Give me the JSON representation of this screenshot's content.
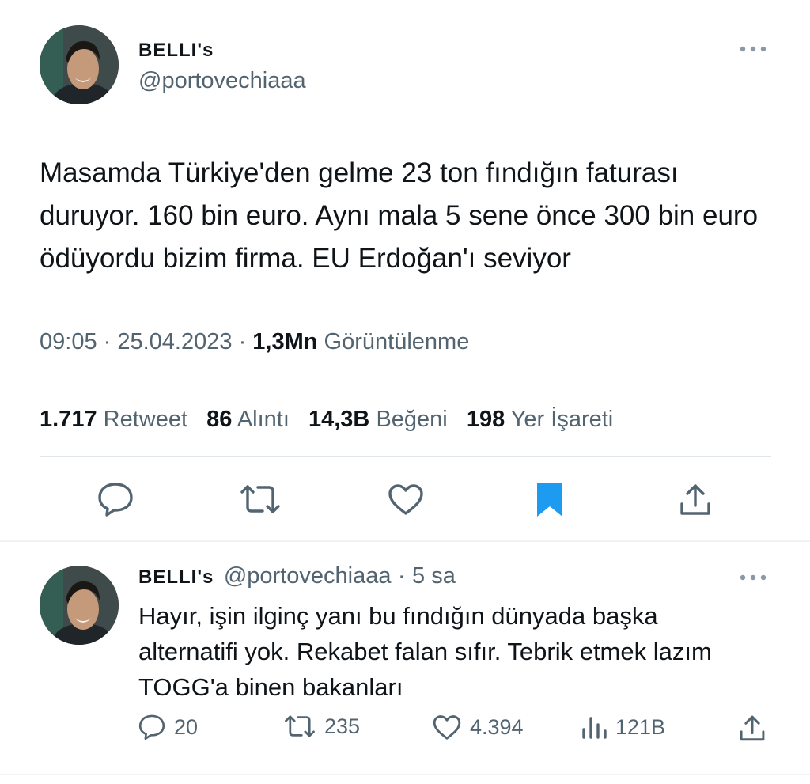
{
  "tweet": {
    "author_name": "BELLI's",
    "author_handle": "@portovechiaaa",
    "text": "Masamda Türkiye'den gelme 23 ton fındığın faturası duruyor. 160 bin euro. Aynı mala 5 sene önce 300 bin euro ödüyordu bizim firma. EU Erdoğan'ı seviyor",
    "time": "09:05",
    "date": "25.04.2023",
    "views_count": "1,3Mn",
    "views_label": "Görüntülenme",
    "stats": [
      {
        "count": "1.717",
        "label": "Retweet"
      },
      {
        "count": "86",
        "label": "Alıntı"
      },
      {
        "count": "14,3B",
        "label": "Beğeni"
      },
      {
        "count": "198",
        "label": "Yer İşareti"
      }
    ],
    "actions": [
      "reply-icon",
      "retweet-icon",
      "like-icon",
      "bookmark-icon",
      "share-icon"
    ],
    "bookmark_color": "#1d9bf0"
  },
  "reply": {
    "author_name": "BELLI's",
    "author_handle": "@portovechiaaa",
    "separator": "·",
    "age": "5 sa",
    "text": "Hayır, işin ilginç yanı bu fındığın dünyada başka alternatifi yok. Rekabet falan sıfır. Tebrik etmek lazım TOGG'a binen bakanları",
    "replies": "20",
    "retweets": "235",
    "likes": "4.394",
    "views": "121B"
  },
  "colors": {
    "text": "#0f1419",
    "secondary": "#536471",
    "divider": "#eff3f4",
    "accent": "#1d9bf0"
  }
}
